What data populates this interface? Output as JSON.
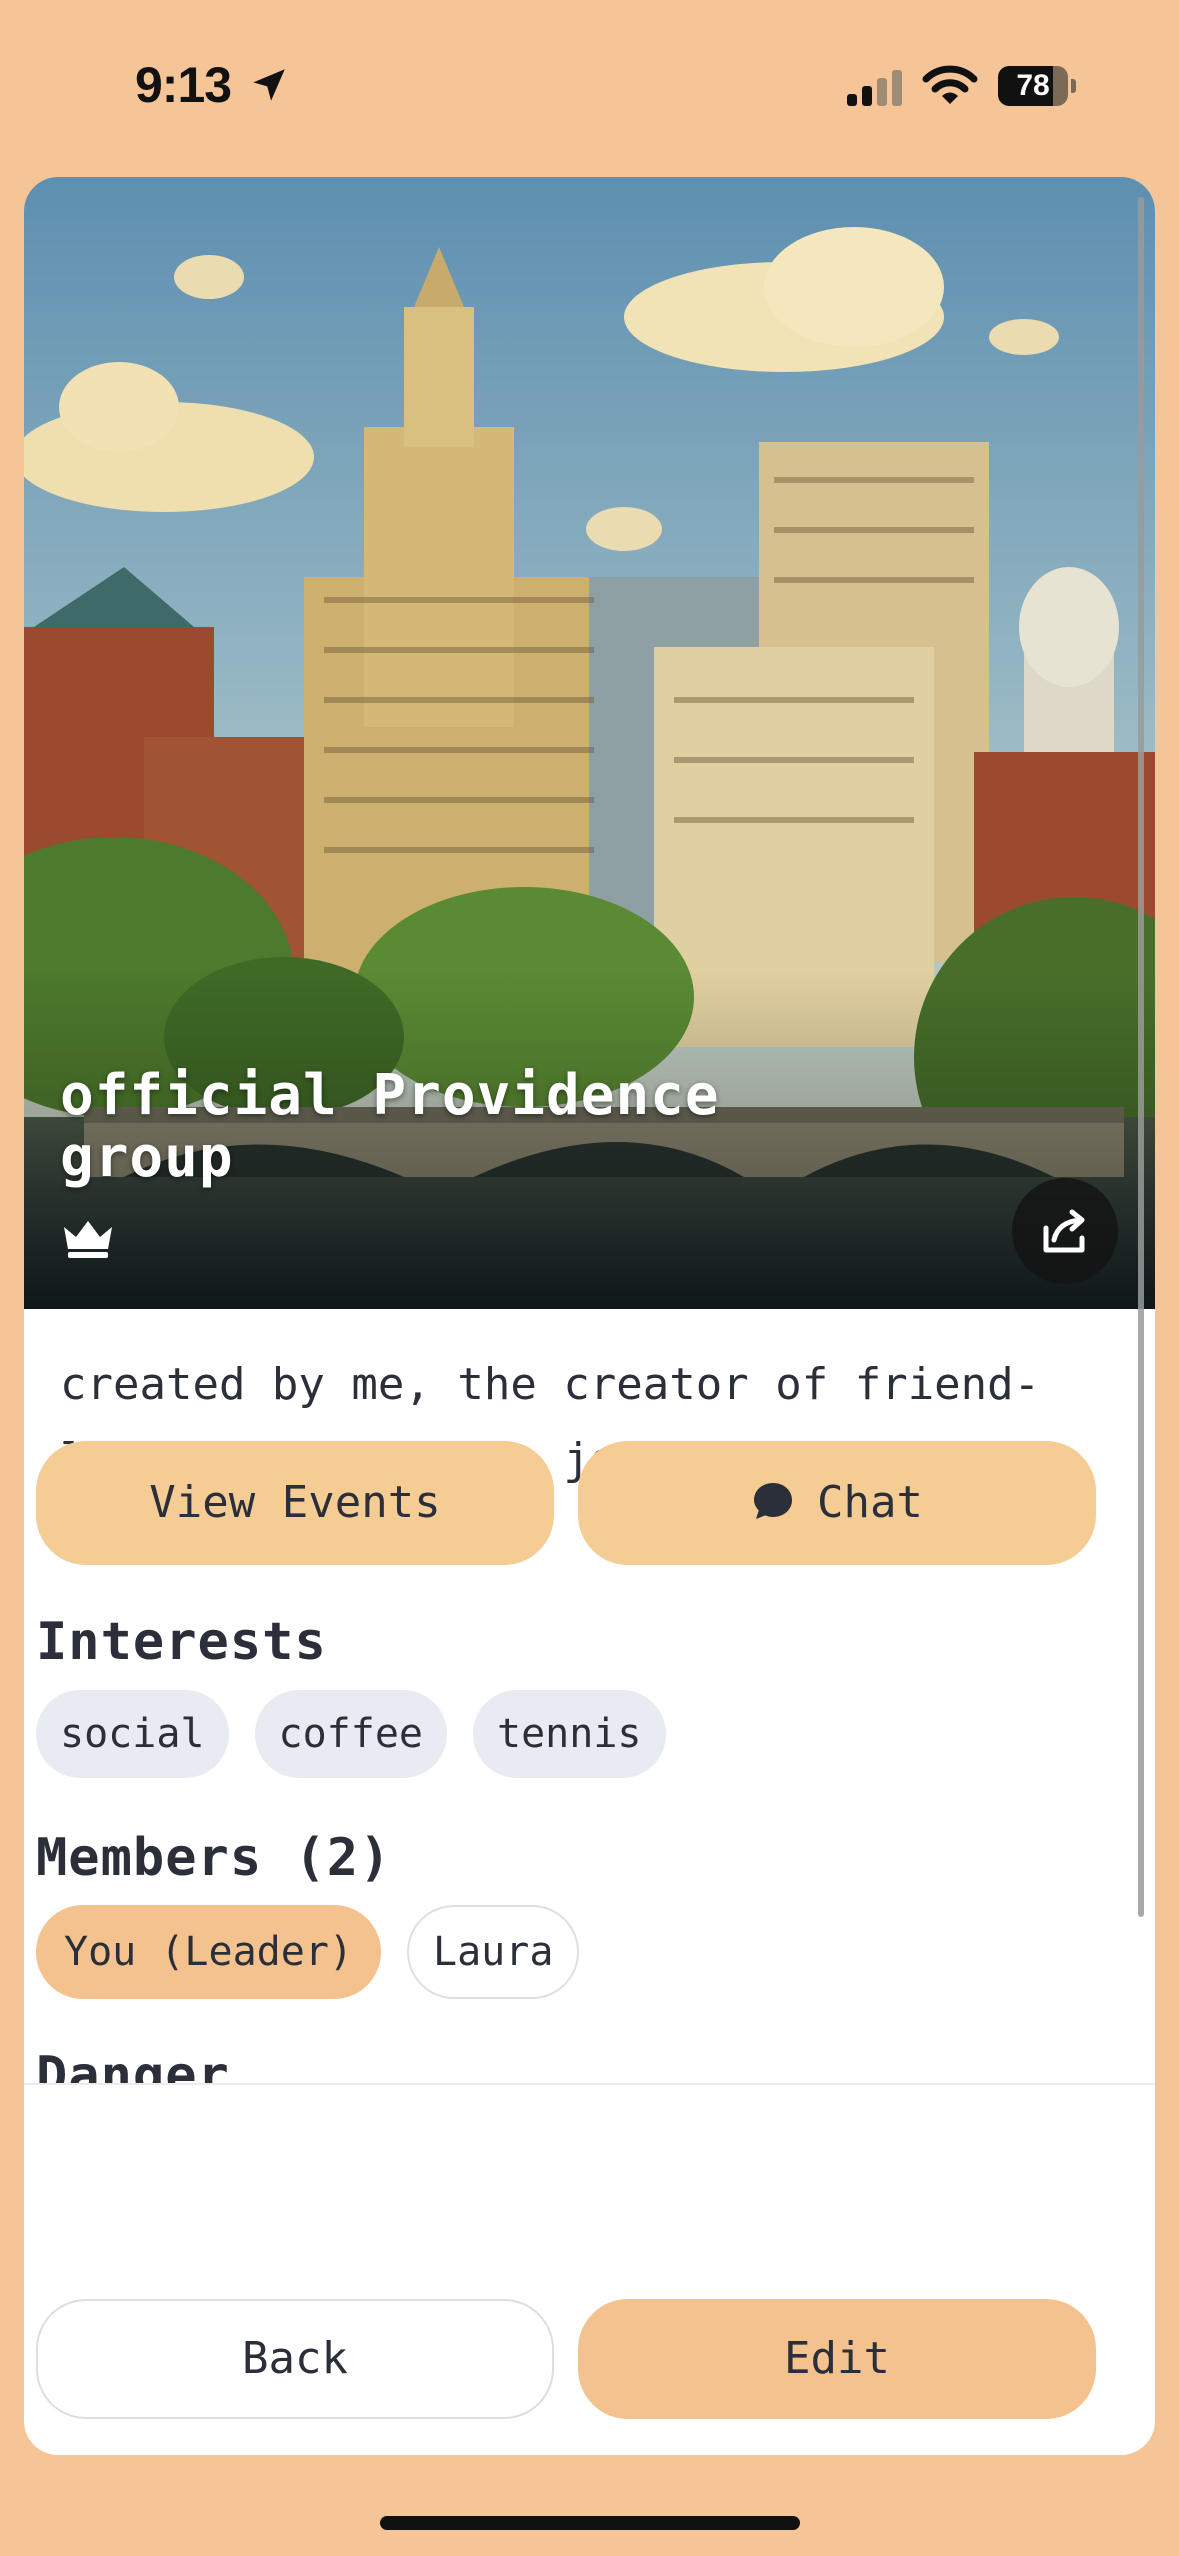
{
  "status_bar": {
    "time": "9:13",
    "battery": "78",
    "battery_level": 0.78
  },
  "group": {
    "title": "official Providence group",
    "description": "created by me, the creator of friend-link. feel free to join and post some events!"
  },
  "actions": {
    "view_events": "View Events",
    "chat": "Chat"
  },
  "interests": {
    "title": "Interests",
    "items": [
      "social",
      "coffee",
      "tennis"
    ]
  },
  "members": {
    "title": "Members (2)",
    "items": [
      {
        "label": "You (Leader)",
        "role": "leader"
      },
      {
        "label": "Laura",
        "role": "member"
      }
    ]
  },
  "danger": {
    "title": "Danger"
  },
  "footer": {
    "back": "Back",
    "edit": "Edit"
  },
  "colors": {
    "background": "#F5C597",
    "button": "#F5CC94",
    "accent": "#F4C28F",
    "chip": "#E8EBF1",
    "text": "#2B2F3A"
  },
  "icons": [
    "location-arrow-icon",
    "signal-icon",
    "wifi-icon",
    "battery-icon",
    "crown-icon",
    "share-icon",
    "chat-bubble-icon"
  ]
}
